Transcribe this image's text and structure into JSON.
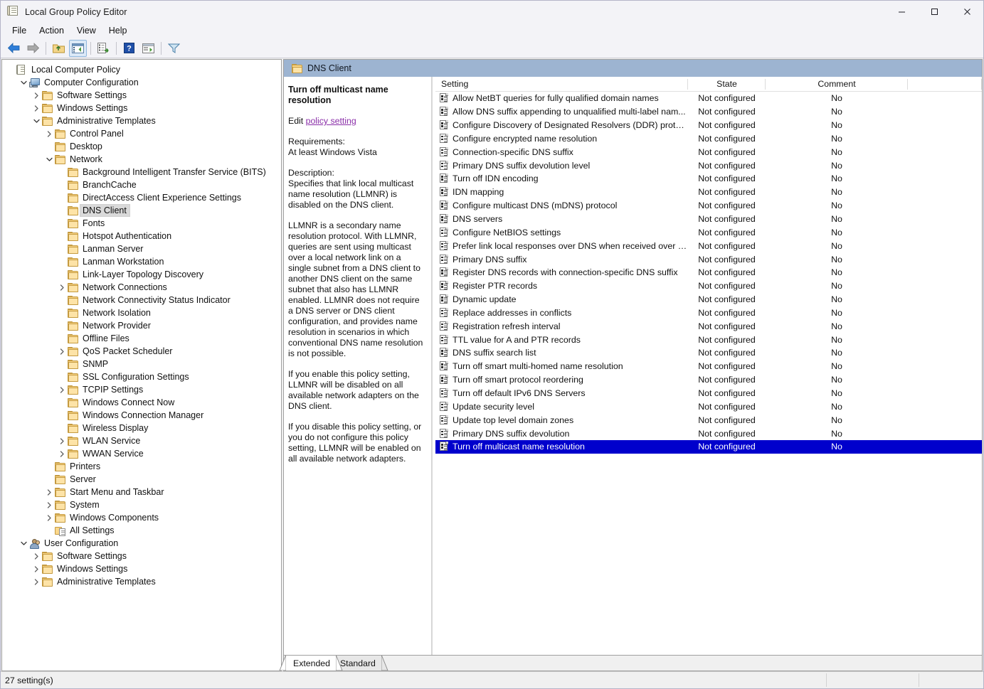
{
  "window": {
    "title": "Local Group Policy Editor",
    "app_icon": "policy-document-icon",
    "minimize": "—",
    "maximize": "☐",
    "close": "✕"
  },
  "menubar": [
    {
      "label": "File"
    },
    {
      "label": "Action"
    },
    {
      "label": "View"
    },
    {
      "label": "Help"
    }
  ],
  "toolbar": [
    {
      "name": "back-icon",
      "icon": "arrow-left"
    },
    {
      "name": "forward-icon",
      "icon": "arrow-right"
    },
    {
      "name": "separator-1",
      "icon": "separator"
    },
    {
      "name": "up-one-level-icon",
      "icon": "folder-up"
    },
    {
      "name": "show-hide-console-tree-icon",
      "icon": "console-tree"
    },
    {
      "name": "separator-2",
      "icon": "separator"
    },
    {
      "name": "export-list-icon",
      "icon": "export-list"
    },
    {
      "name": "separator-3",
      "icon": "separator"
    },
    {
      "name": "help-icon",
      "icon": "question"
    },
    {
      "name": "show-hide-action-pane-icon",
      "icon": "action-pane"
    },
    {
      "name": "separator-4",
      "icon": "separator"
    },
    {
      "name": "filter-icon",
      "icon": "funnel"
    }
  ],
  "tree": [
    {
      "label": "Local Computer Policy",
      "indent": 0,
      "twisty": "none",
      "icon": "policy-scroll",
      "selected": false
    },
    {
      "label": "Computer Configuration",
      "indent": 1,
      "twisty": "expanded",
      "icon": "computer",
      "selected": false
    },
    {
      "label": "Software Settings",
      "indent": 2,
      "twisty": "collapsed",
      "icon": "folder",
      "selected": false
    },
    {
      "label": "Windows Settings",
      "indent": 2,
      "twisty": "collapsed",
      "icon": "folder",
      "selected": false
    },
    {
      "label": "Administrative Templates",
      "indent": 2,
      "twisty": "expanded",
      "icon": "folder",
      "selected": false
    },
    {
      "label": "Control Panel",
      "indent": 3,
      "twisty": "collapsed",
      "icon": "folder",
      "selected": false
    },
    {
      "label": "Desktop",
      "indent": 3,
      "twisty": "none",
      "icon": "folder",
      "selected": false
    },
    {
      "label": "Network",
      "indent": 3,
      "twisty": "expanded",
      "icon": "folder",
      "selected": false
    },
    {
      "label": "Background Intelligent Transfer Service (BITS)",
      "indent": 4,
      "twisty": "none",
      "icon": "folder",
      "selected": false
    },
    {
      "label": "BranchCache",
      "indent": 4,
      "twisty": "none",
      "icon": "folder",
      "selected": false
    },
    {
      "label": "DirectAccess Client Experience Settings",
      "indent": 4,
      "twisty": "none",
      "icon": "folder",
      "selected": false
    },
    {
      "label": "DNS Client",
      "indent": 4,
      "twisty": "none",
      "icon": "folder",
      "selected": true
    },
    {
      "label": "Fonts",
      "indent": 4,
      "twisty": "none",
      "icon": "folder",
      "selected": false
    },
    {
      "label": "Hotspot Authentication",
      "indent": 4,
      "twisty": "none",
      "icon": "folder",
      "selected": false
    },
    {
      "label": "Lanman Server",
      "indent": 4,
      "twisty": "none",
      "icon": "folder",
      "selected": false
    },
    {
      "label": "Lanman Workstation",
      "indent": 4,
      "twisty": "none",
      "icon": "folder",
      "selected": false
    },
    {
      "label": "Link-Layer Topology Discovery",
      "indent": 4,
      "twisty": "none",
      "icon": "folder",
      "selected": false
    },
    {
      "label": "Network Connections",
      "indent": 4,
      "twisty": "collapsed",
      "icon": "folder",
      "selected": false
    },
    {
      "label": "Network Connectivity Status Indicator",
      "indent": 4,
      "twisty": "none",
      "icon": "folder",
      "selected": false
    },
    {
      "label": "Network Isolation",
      "indent": 4,
      "twisty": "none",
      "icon": "folder",
      "selected": false
    },
    {
      "label": "Network Provider",
      "indent": 4,
      "twisty": "none",
      "icon": "folder",
      "selected": false
    },
    {
      "label": "Offline Files",
      "indent": 4,
      "twisty": "none",
      "icon": "folder",
      "selected": false
    },
    {
      "label": "QoS Packet Scheduler",
      "indent": 4,
      "twisty": "collapsed",
      "icon": "folder",
      "selected": false
    },
    {
      "label": "SNMP",
      "indent": 4,
      "twisty": "none",
      "icon": "folder",
      "selected": false
    },
    {
      "label": "SSL Configuration Settings",
      "indent": 4,
      "twisty": "none",
      "icon": "folder",
      "selected": false
    },
    {
      "label": "TCPIP Settings",
      "indent": 4,
      "twisty": "collapsed",
      "icon": "folder",
      "selected": false
    },
    {
      "label": "Windows Connect Now",
      "indent": 4,
      "twisty": "none",
      "icon": "folder",
      "selected": false
    },
    {
      "label": "Windows Connection Manager",
      "indent": 4,
      "twisty": "none",
      "icon": "folder",
      "selected": false
    },
    {
      "label": "Wireless Display",
      "indent": 4,
      "twisty": "none",
      "icon": "folder",
      "selected": false
    },
    {
      "label": "WLAN Service",
      "indent": 4,
      "twisty": "collapsed",
      "icon": "folder",
      "selected": false
    },
    {
      "label": "WWAN Service",
      "indent": 4,
      "twisty": "collapsed",
      "icon": "folder",
      "selected": false
    },
    {
      "label": "Printers",
      "indent": 3,
      "twisty": "none",
      "icon": "folder",
      "selected": false
    },
    {
      "label": "Server",
      "indent": 3,
      "twisty": "none",
      "icon": "folder",
      "selected": false
    },
    {
      "label": "Start Menu and Taskbar",
      "indent": 3,
      "twisty": "collapsed",
      "icon": "folder",
      "selected": false
    },
    {
      "label": "System",
      "indent": 3,
      "twisty": "collapsed",
      "icon": "folder",
      "selected": false
    },
    {
      "label": "Windows Components",
      "indent": 3,
      "twisty": "collapsed",
      "icon": "folder",
      "selected": false
    },
    {
      "label": "All Settings",
      "indent": 3,
      "twisty": "none",
      "icon": "all-settings",
      "selected": false
    },
    {
      "label": "User Configuration",
      "indent": 1,
      "twisty": "expanded",
      "icon": "user",
      "selected": false
    },
    {
      "label": "Software Settings",
      "indent": 2,
      "twisty": "collapsed",
      "icon": "folder",
      "selected": false
    },
    {
      "label": "Windows Settings",
      "indent": 2,
      "twisty": "collapsed",
      "icon": "folder",
      "selected": false
    },
    {
      "label": "Administrative Templates",
      "indent": 2,
      "twisty": "collapsed",
      "icon": "folder",
      "selected": false
    }
  ],
  "content_header": {
    "icon": "folder-icon",
    "title": "DNS Client"
  },
  "description": {
    "title": "Turn off multicast name resolution",
    "edit_prefix": "Edit ",
    "edit_link": "policy setting",
    "requirements_label": "Requirements:",
    "requirements_value": "At least Windows Vista",
    "description_label": "Description:",
    "paragraph_1": "Specifies that link local multicast name resolution (LLMNR) is disabled on the DNS client.",
    "paragraph_2": "LLMNR is a secondary name resolution protocol. With LLMNR, queries are sent using multicast over a local network link on a single subnet from a DNS client to another DNS client on the same subnet that also has LLMNR enabled. LLMNR does not require a DNS server or DNS client configuration, and provides name resolution in scenarios in which conventional DNS name resolution is not possible.",
    "paragraph_3": "If you enable this policy setting, LLMNR will be disabled on all available network adapters on the DNS client.",
    "paragraph_4": "If you disable this policy setting, or you do not configure this policy setting, LLMNR will be enabled on all available network adapters."
  },
  "list": {
    "columns": [
      "Setting",
      "State",
      "Comment"
    ],
    "rows": [
      {
        "setting": "Allow NetBT queries for fully qualified domain names",
        "state": "Not configured",
        "comment": "No",
        "selected": false
      },
      {
        "setting": "Allow DNS suffix appending to unqualified multi-label nam...",
        "state": "Not configured",
        "comment": "No",
        "selected": false
      },
      {
        "setting": "Configure Discovery of Designated Resolvers (DDR) protocol",
        "state": "Not configured",
        "comment": "No",
        "selected": false
      },
      {
        "setting": "Configure encrypted name resolution",
        "state": "Not configured",
        "comment": "No",
        "selected": false
      },
      {
        "setting": "Connection-specific DNS suffix",
        "state": "Not configured",
        "comment": "No",
        "selected": false
      },
      {
        "setting": "Primary DNS suffix devolution level",
        "state": "Not configured",
        "comment": "No",
        "selected": false
      },
      {
        "setting": "Turn off IDN encoding",
        "state": "Not configured",
        "comment": "No",
        "selected": false
      },
      {
        "setting": "IDN mapping",
        "state": "Not configured",
        "comment": "No",
        "selected": false
      },
      {
        "setting": "Configure multicast DNS (mDNS) protocol",
        "state": "Not configured",
        "comment": "No",
        "selected": false
      },
      {
        "setting": "DNS servers",
        "state": "Not configured",
        "comment": "No",
        "selected": false
      },
      {
        "setting": "Configure NetBIOS settings",
        "state": "Not configured",
        "comment": "No",
        "selected": false
      },
      {
        "setting": "Prefer link local responses over DNS when received over a n...",
        "state": "Not configured",
        "comment": "No",
        "selected": false
      },
      {
        "setting": "Primary DNS suffix",
        "state": "Not configured",
        "comment": "No",
        "selected": false
      },
      {
        "setting": "Register DNS records with connection-specific DNS suffix",
        "state": "Not configured",
        "comment": "No",
        "selected": false
      },
      {
        "setting": "Register PTR records",
        "state": "Not configured",
        "comment": "No",
        "selected": false
      },
      {
        "setting": "Dynamic update",
        "state": "Not configured",
        "comment": "No",
        "selected": false
      },
      {
        "setting": "Replace addresses in conflicts",
        "state": "Not configured",
        "comment": "No",
        "selected": false
      },
      {
        "setting": "Registration refresh interval",
        "state": "Not configured",
        "comment": "No",
        "selected": false
      },
      {
        "setting": "TTL value for A and PTR records",
        "state": "Not configured",
        "comment": "No",
        "selected": false
      },
      {
        "setting": "DNS suffix search list",
        "state": "Not configured",
        "comment": "No",
        "selected": false
      },
      {
        "setting": "Turn off smart multi-homed name resolution",
        "state": "Not configured",
        "comment": "No",
        "selected": false
      },
      {
        "setting": "Turn off smart protocol reordering",
        "state": "Not configured",
        "comment": "No",
        "selected": false
      },
      {
        "setting": "Turn off default IPv6 DNS Servers",
        "state": "Not configured",
        "comment": "No",
        "selected": false
      },
      {
        "setting": "Update security level",
        "state": "Not configured",
        "comment": "No",
        "selected": false
      },
      {
        "setting": "Update top level domain zones",
        "state": "Not configured",
        "comment": "No",
        "selected": false
      },
      {
        "setting": "Primary DNS suffix devolution",
        "state": "Not configured",
        "comment": "No",
        "selected": false
      },
      {
        "setting": "Turn off multicast name resolution",
        "state": "Not configured",
        "comment": "No",
        "selected": true
      }
    ]
  },
  "tabs": [
    {
      "label": "Extended",
      "active": true
    },
    {
      "label": "Standard",
      "active": false
    }
  ],
  "statusbar": {
    "text": "27 setting(s)"
  },
  "colors": {
    "header_band": "#9db4d1",
    "selection": "#0000cc",
    "link": "#8a2ea8",
    "folder": "#fcd88b"
  }
}
